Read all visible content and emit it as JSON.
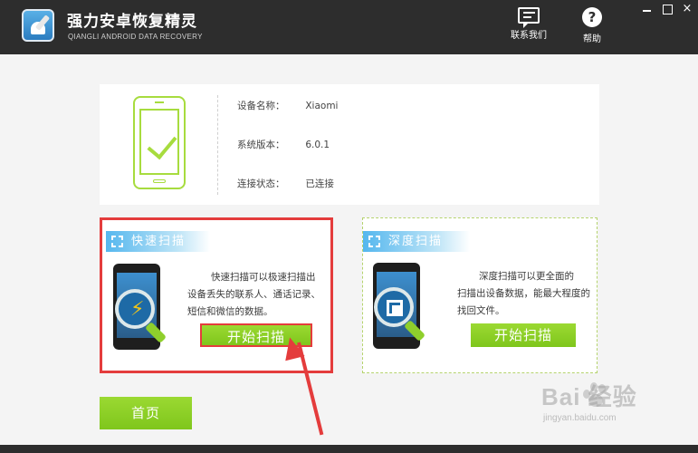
{
  "app": {
    "title": "强力安卓恢复精灵",
    "subtitle": "QIANGLI ANDROID DATA RECOVERY",
    "logo_icon": "android-repair-logo"
  },
  "header": {
    "contact_label": "联系我们",
    "contact_icon": "chat-icon",
    "help_label": "帮助",
    "help_icon": "help-icon",
    "help_glyph": "?"
  },
  "window_controls": {
    "close_glyph": "×"
  },
  "device": {
    "name_key": "设备名称：",
    "name_value": "Xiaomi",
    "version_key": "系统版本：",
    "version_value": "6.0.1",
    "status_key": "连接状态：",
    "status_value": "已连接",
    "status_icon": "phone-check-icon"
  },
  "quick_scan": {
    "title": "快速扫描",
    "desc_line1": "快速扫描可以极速扫描出",
    "desc_line2": "设备丢失的联系人、通话记录、短信和微信的数据。",
    "button_label": "开始扫描",
    "icon": "lightning-magnifier-icon",
    "bolt_glyph": "⚡"
  },
  "deep_scan": {
    "title": "深度扫描",
    "desc_line1": "深度扫描可以更全面的",
    "desc_line2": "扫描出设备数据，能最大程度的找回文件。",
    "button_label": "开始扫描",
    "icon": "layers-magnifier-icon"
  },
  "footer": {
    "home_label": "首页"
  },
  "watermark": {
    "brand": "Bai  经验",
    "url": "jingyan.baidu.com"
  },
  "colors": {
    "titlebar": "#2d2d2d",
    "accent_green": "#8fcf2c",
    "accent_blue": "#55b7ee",
    "highlight_red": "#e43c3c"
  }
}
